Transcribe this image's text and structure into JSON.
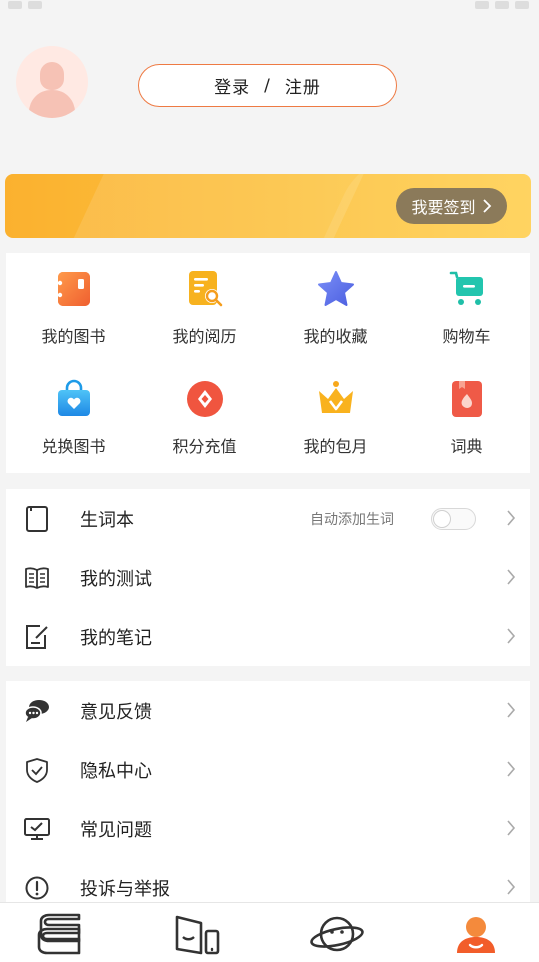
{
  "auth": {
    "login_label": "登录",
    "separator": "/",
    "register_label": "注册"
  },
  "banner": {
    "signin_label": "我要签到"
  },
  "grid": [
    {
      "label": "我的图书",
      "icon": "book-icon"
    },
    {
      "label": "我的阅历",
      "icon": "reading-history-icon"
    },
    {
      "label": "我的收藏",
      "icon": "star-icon"
    },
    {
      "label": "购物车",
      "icon": "cart-icon"
    },
    {
      "label": "兑换图书",
      "icon": "bag-icon"
    },
    {
      "label": "积分充值",
      "icon": "points-icon"
    },
    {
      "label": "我的包月",
      "icon": "crown-icon"
    },
    {
      "label": "词典",
      "icon": "dictionary-icon"
    }
  ],
  "list1": [
    {
      "label": "生词本",
      "hint": "自动添加生词",
      "icon": "notebook-icon"
    },
    {
      "label": "我的测试",
      "icon": "test-book-icon"
    },
    {
      "label": "我的笔记",
      "icon": "note-edit-icon"
    }
  ],
  "list2": [
    {
      "label": "意见反馈",
      "icon": "chat-bubbles-icon"
    },
    {
      "label": "隐私中心",
      "icon": "shield-icon"
    },
    {
      "label": "常见问题",
      "icon": "monitor-check-icon"
    },
    {
      "label": "投诉与举报",
      "icon": "alert-circle-icon"
    }
  ],
  "tabs": [
    {
      "icon": "bookshelf-icon"
    },
    {
      "icon": "store-icon"
    },
    {
      "icon": "planet-icon"
    },
    {
      "icon": "profile-icon",
      "active": true
    }
  ],
  "colors": {
    "accent": "#ee7a43",
    "banner": "#fbb12f",
    "signin": "#8b7a5a"
  }
}
